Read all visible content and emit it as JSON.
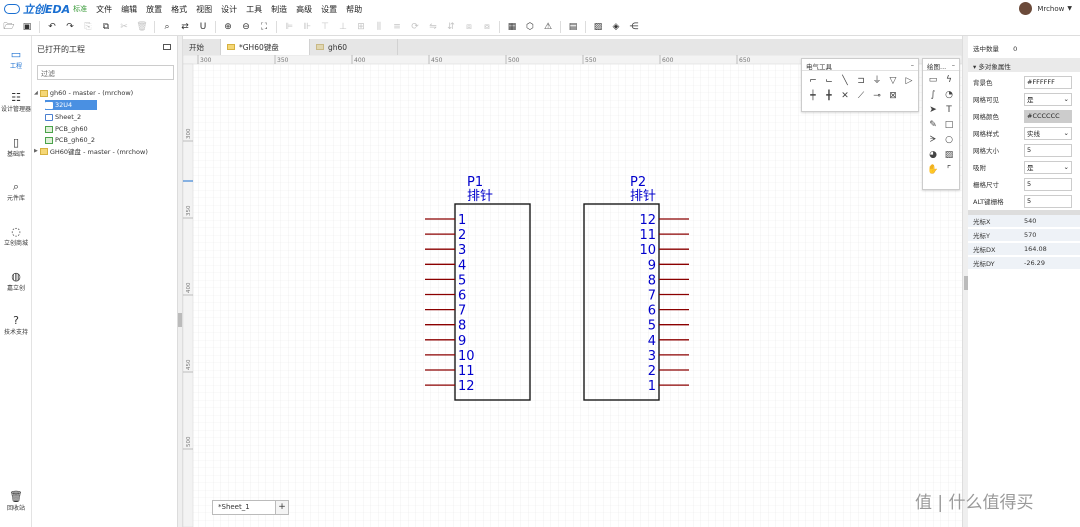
{
  "app": {
    "logo_text": "立创EDA",
    "edition": "标准"
  },
  "menu": [
    "文件",
    "编辑",
    "放置",
    "格式",
    "视图",
    "设计",
    "工具",
    "制造",
    "高级",
    "设置",
    "帮助"
  ],
  "user": {
    "name": "Mrchow"
  },
  "rail": [
    {
      "label": "工程",
      "icon": "folder-icon"
    },
    {
      "label": "设计管理器",
      "icon": "tree-icon"
    },
    {
      "label": "基础库",
      "icon": "chip-icon"
    },
    {
      "label": "元件库",
      "icon": "search-icon"
    },
    {
      "label": "立创商城",
      "icon": "lcsc-icon"
    },
    {
      "label": "嘉立创",
      "icon": "jlc-icon"
    },
    {
      "label": "技术支持",
      "icon": "help-icon"
    },
    {
      "label": "回收站",
      "icon": "trash-icon"
    }
  ],
  "project_panel": {
    "title": "已打开的工程",
    "filter_placeholder": "过滤",
    "tree": [
      {
        "label": "gh60 - master - (mrchow)"
      },
      {
        "label": "32U4"
      },
      {
        "label": "Sheet_2"
      },
      {
        "label": "PCB_gh60"
      },
      {
        "label": "PCB_gh60_2"
      },
      {
        "label": "GH60键盘 - master - (mrchow)"
      }
    ]
  },
  "tabs": [
    "开始",
    "*GH60键盘",
    "gh60"
  ],
  "ruler": [
    "300",
    "350",
    "400",
    "450",
    "500",
    "550",
    "600",
    "650"
  ],
  "ruler_v": [
    "300",
    "350",
    "400",
    "450",
    "500"
  ],
  "electrical_tools": {
    "title": "电气工具"
  },
  "drawing_tools": {
    "title": "绘图..."
  },
  "schematic": {
    "p1": {
      "ref": "P1",
      "name": "排针",
      "pins": [
        "1",
        "2",
        "3",
        "4",
        "5",
        "6",
        "7",
        "8",
        "9",
        "10",
        "11",
        "12"
      ]
    },
    "p2": {
      "ref": "P2",
      "name": "排针",
      "pins": [
        "12",
        "11",
        "10",
        "9",
        "8",
        "7",
        "6",
        "5",
        "4",
        "3",
        "2",
        "1"
      ]
    }
  },
  "sheet_tab": "*Sheet_1",
  "properties": {
    "selected_label": "选中数量",
    "selected_count": "0",
    "section_title": "多对象属性",
    "rows": [
      {
        "label": "背景色",
        "value": "#FFFFFF"
      },
      {
        "label": "网格可见",
        "value": "是"
      },
      {
        "label": "网格颜色",
        "value": "#CCCCCC"
      },
      {
        "label": "网格样式",
        "value": "实线"
      },
      {
        "label": "网格大小",
        "value": "5"
      },
      {
        "label": "吸附",
        "value": "是"
      },
      {
        "label": "栅格尺寸",
        "value": "5"
      },
      {
        "label": "ALT键栅格",
        "value": "5"
      }
    ],
    "coords": [
      {
        "label": "光标X",
        "value": "540"
      },
      {
        "label": "光标Y",
        "value": "570"
      },
      {
        "label": "光标DX",
        "value": "164.08"
      },
      {
        "label": "光标DY",
        "value": "-26.29"
      }
    ]
  },
  "watermark": "值 | 什么值得买",
  "colors": {
    "accent": "#1a6fd1",
    "pin": "#8b0000",
    "label": "#0000cc",
    "selection": "#4a90e2"
  }
}
